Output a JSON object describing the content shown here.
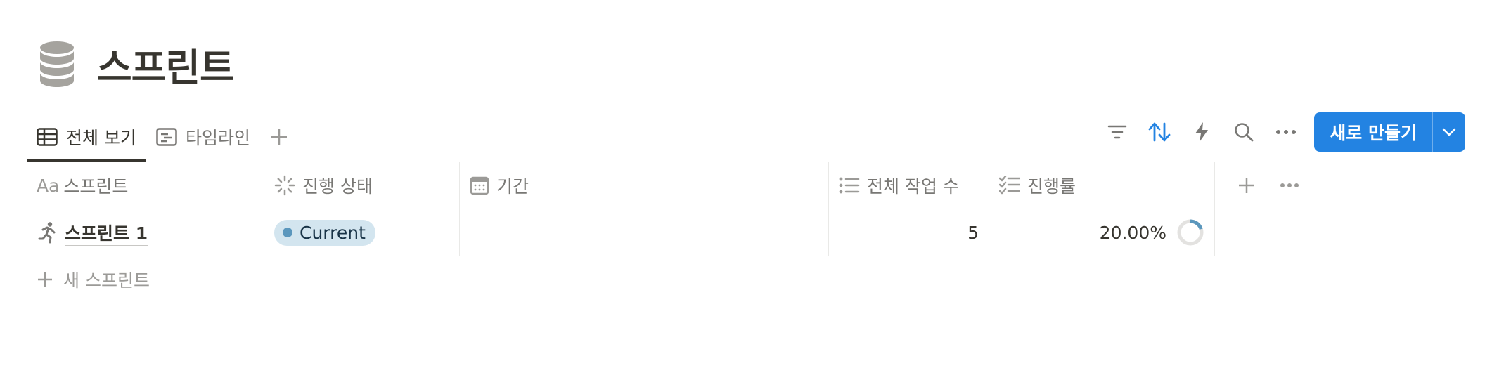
{
  "page": {
    "title": "스프린트",
    "icon": "database-icon"
  },
  "views": {
    "tabs": [
      {
        "label": "전체 보기",
        "icon": "table-icon",
        "active": true
      },
      {
        "label": "타임라인",
        "icon": "timeline-icon",
        "active": false
      }
    ],
    "add_icon": "plus-icon"
  },
  "toolbar": {
    "icons": [
      "filter-icon",
      "sort-icon",
      "lightning-icon",
      "search-icon",
      "more-icon"
    ],
    "new_button_label": "새로 만들기",
    "accent": "#2383e2"
  },
  "table": {
    "columns": [
      {
        "label": "스프린트",
        "icon": "title-icon",
        "prefix": "Aa"
      },
      {
        "label": "진행 상태",
        "icon": "status-icon"
      },
      {
        "label": "기간",
        "icon": "calendar-icon"
      },
      {
        "label": "전체 작업 수",
        "icon": "list-icon"
      },
      {
        "label": "진행률",
        "icon": "checklist-icon"
      }
    ],
    "rows": [
      {
        "name": "스프린트 1",
        "icon": "running-icon",
        "status": "Current",
        "status_color": "#d3e5ef",
        "period": "",
        "task_count": "5",
        "progress_label": "20.00%",
        "progress_fraction": 0.2
      }
    ],
    "new_row_label": "새 스프린트"
  }
}
